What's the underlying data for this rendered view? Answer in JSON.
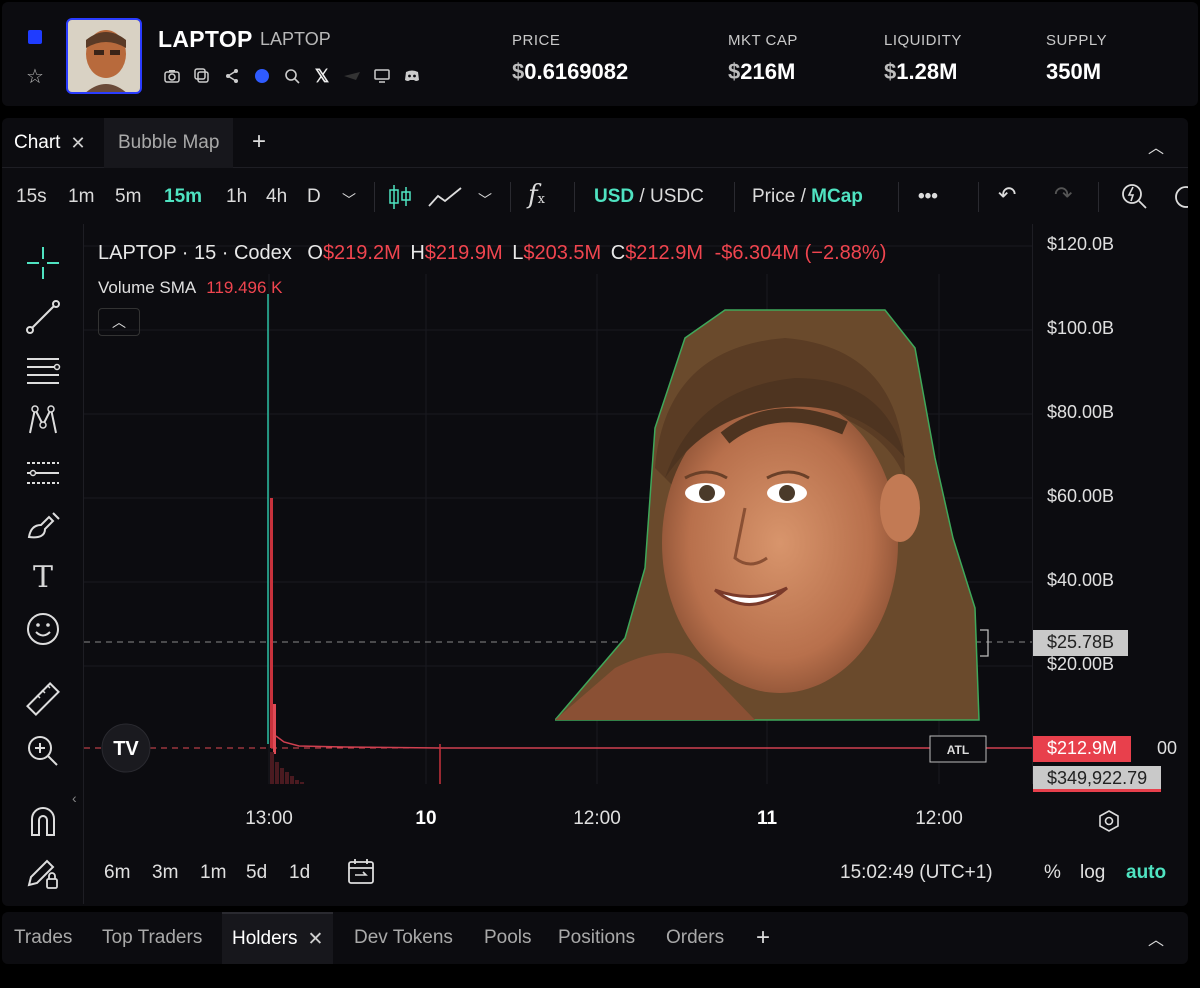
{
  "header": {
    "token_name": "LAPTOP",
    "token_symbol": "LAPTOP",
    "stats": [
      {
        "label": "PRICE",
        "currency": "$",
        "value": "0.6169082"
      },
      {
        "label": "MKT CAP",
        "currency": "$",
        "value": "216M"
      },
      {
        "label": "LIQUIDITY",
        "currency": "$",
        "value": "1.28M"
      },
      {
        "label": "SUPPLY",
        "currency": "",
        "value": "350M"
      }
    ],
    "icons": [
      "camera-icon",
      "copy-icon",
      "share-icon",
      "chain-icon",
      "search-icon",
      "x-icon",
      "telegram-icon",
      "monitor-icon",
      "discord-icon"
    ]
  },
  "chart_tabs": {
    "tabs": [
      {
        "label": "Chart"
      },
      {
        "label": "Bubble Map"
      }
    ],
    "add": "+"
  },
  "toolbar": {
    "intervals": [
      "15s",
      "1m",
      "5m",
      "15m",
      "1h",
      "4h",
      "D"
    ],
    "selected_interval": "15m",
    "fx": "f",
    "currency_a": "USD",
    "currency_sep": " / ",
    "currency_b": "USDC",
    "price_label": "Price",
    "mode_sep": " / ",
    "mcap_label": "MCap",
    "more": "•••"
  },
  "legend": {
    "title": "LAPTOP · 15 · Codex",
    "o_label": "O",
    "o_value": "$219.2M",
    "h_label": "H",
    "h_value": "$219.9M",
    "l_label": "L",
    "l_value": "$203.5M",
    "c_label": "C",
    "c_value": "$212.9M",
    "change": "-$6.304M (−2.88%)",
    "volume_label": "Volume SMA",
    "volume_value": "119.496 K"
  },
  "y_axis": {
    "labels": [
      "$120.0B",
      "$100.0B",
      "$80.00B",
      "$60.00B",
      "$40.00B",
      "$20.00B"
    ],
    "tag_grey": "$25.78B",
    "tag_red": "$212.9M",
    "tag_red_suffix": "00",
    "tag_light": "$349,922.79",
    "atl": "ATL"
  },
  "x_axis": {
    "labels": [
      {
        "text": "13:00",
        "bold": false
      },
      {
        "text": "10",
        "bold": true
      },
      {
        "text": "12:00",
        "bold": false
      },
      {
        "text": "11",
        "bold": true
      },
      {
        "text": "12:00",
        "bold": false
      }
    ]
  },
  "range": {
    "presets": [
      "6m",
      "3m",
      "1m",
      "5d",
      "1d"
    ],
    "time": "15:02:49 (UTC+1)",
    "percent": "%",
    "log": "log",
    "auto": "auto"
  },
  "bottom_tabs": {
    "tabs": [
      "Trades",
      "Top Traders",
      "Holders",
      "Dev Tokens",
      "Pools",
      "Positions",
      "Orders"
    ],
    "active": "Holders",
    "add": "+"
  },
  "colors": {
    "accent": "#4fe3c1",
    "down": "#f0454f",
    "brand_blue": "#1f3cff",
    "background": "#0c0c10"
  }
}
